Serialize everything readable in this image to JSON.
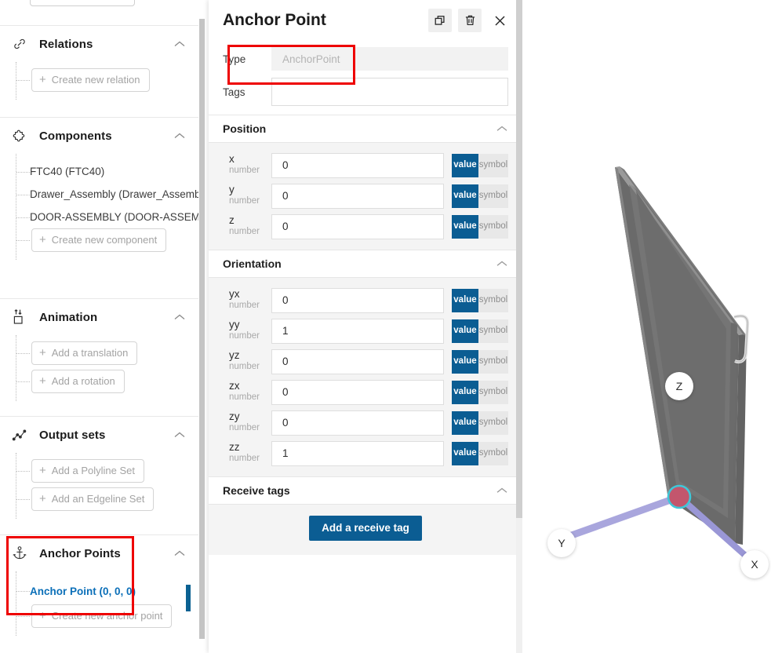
{
  "sidebar": {
    "sections": [
      {
        "title": "Relations",
        "icon": "link-icon",
        "collapse_icon": "chevron-up-icon",
        "leaves": [],
        "buttons": [
          {
            "label": "Create new relation",
            "plus": "+"
          }
        ]
      },
      {
        "title": "Components",
        "icon": "puzzle-icon",
        "collapse_icon": "chevron-up-icon",
        "leaves": [
          {
            "label": "FTC40 (FTC40)"
          },
          {
            "label": "Drawer_Assembly (Drawer_Assembly)"
          },
          {
            "label": "DOOR-ASSEMBLY (DOOR-ASSEMBLY)"
          }
        ],
        "buttons": [
          {
            "label": "Create new component",
            "plus": "+"
          }
        ]
      },
      {
        "title": "Animation",
        "icon": "translate-icon",
        "collapse_icon": "chevron-up-icon",
        "leaves": [],
        "buttons": [
          {
            "label": "Add a translation",
            "plus": "+"
          },
          {
            "label": "Add a rotation",
            "plus": "+"
          }
        ]
      },
      {
        "title": "Output sets",
        "icon": "polyline-icon",
        "collapse_icon": "chevron-up-icon",
        "leaves": [],
        "buttons": [
          {
            "label": "Add a Polyline Set",
            "plus": "+"
          },
          {
            "label": "Add an Edgeline Set",
            "plus": "+"
          }
        ]
      },
      {
        "title": "Anchor Points",
        "icon": "anchor-icon",
        "collapse_icon": "chevron-up-icon",
        "leaves": [
          {
            "label": "Anchor Point (0, 0, 0)",
            "selected": true
          }
        ],
        "buttons": [
          {
            "label": "Create new anchor point",
            "plus": "+"
          }
        ]
      }
    ]
  },
  "panel": {
    "title": "Anchor Point",
    "header_actions": [
      {
        "name": "duplicate-button",
        "icon": "copy-icon"
      },
      {
        "name": "delete-button",
        "icon": "trash-icon"
      },
      {
        "name": "close-button",
        "icon": "close-icon"
      }
    ],
    "fields": [
      {
        "label": "Type",
        "value": "AnchorPoint",
        "readonly": true
      },
      {
        "label": "Tags",
        "value": "",
        "readonly": false
      }
    ],
    "sections": [
      {
        "title": "Position",
        "collapse_icon": "chevron-up-icon",
        "rows": [
          {
            "name": "x",
            "type": "number",
            "value": "0",
            "mode": "value",
            "value_label": "value",
            "symbol_label": "symbol"
          },
          {
            "name": "y",
            "type": "number",
            "value": "0",
            "mode": "value",
            "value_label": "value",
            "symbol_label": "symbol"
          },
          {
            "name": "z",
            "type": "number",
            "value": "0",
            "mode": "value",
            "value_label": "value",
            "symbol_label": "symbol"
          }
        ]
      },
      {
        "title": "Orientation",
        "collapse_icon": "chevron-up-icon",
        "rows": [
          {
            "name": "yx",
            "type": "number",
            "value": "0",
            "mode": "value",
            "value_label": "value",
            "symbol_label": "symbol"
          },
          {
            "name": "yy",
            "type": "number",
            "value": "1",
            "mode": "value",
            "value_label": "value",
            "symbol_label": "symbol"
          },
          {
            "name": "yz",
            "type": "number",
            "value": "0",
            "mode": "value",
            "value_label": "value",
            "symbol_label": "symbol"
          },
          {
            "name": "zx",
            "type": "number",
            "value": "0",
            "mode": "value",
            "value_label": "value",
            "symbol_label": "symbol"
          },
          {
            "name": "zy",
            "type": "number",
            "value": "0",
            "mode": "value",
            "value_label": "value",
            "symbol_label": "symbol"
          },
          {
            "name": "zz",
            "type": "number",
            "value": "1",
            "mode": "value",
            "value_label": "value",
            "symbol_label": "symbol"
          }
        ]
      },
      {
        "title": "Receive tags",
        "collapse_icon": "chevron-up-icon",
        "rows": [],
        "button": "Add a receive tag"
      }
    ]
  },
  "viewport": {
    "axes": [
      {
        "label": "Z"
      },
      {
        "label": "Y"
      },
      {
        "label": "X"
      }
    ],
    "model": "door-assembly-3d-model",
    "anchor_marker": "anchor-point-marker"
  },
  "colors": {
    "accent_blue": "#0b5d93",
    "link_blue": "#0b6fb8",
    "annotation_red": "#ee0000",
    "panel_body_gray": "#f4f4f4",
    "axis_line": "#a3a0d8",
    "anchor_marker": "#d4556b"
  }
}
